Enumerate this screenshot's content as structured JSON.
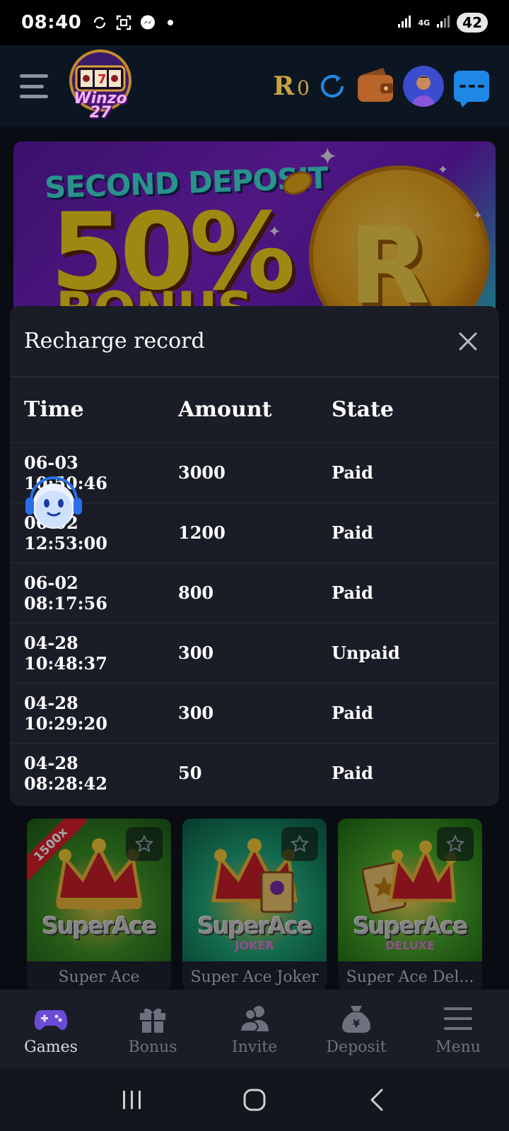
{
  "status_bar": {
    "time": "08:40",
    "network": "4G",
    "battery": "42"
  },
  "header": {
    "logo_text": "Winzo 27",
    "balance_currency": "R",
    "balance_value": "0"
  },
  "banner": {
    "line1": "SECOND DEPOSIT",
    "line2": "50%",
    "line3": "BONUS",
    "coin_symbol": "R"
  },
  "recharge_record": {
    "title": "Recharge record",
    "columns": [
      "Time",
      "Amount",
      "State"
    ],
    "rows": [
      {
        "time": "06-03 10:50:46",
        "amount": "3000",
        "state": "Paid"
      },
      {
        "time": "06-02 12:53:00",
        "amount": "1200",
        "state": "Paid"
      },
      {
        "time": "06-02 08:17:56",
        "amount": "800",
        "state": "Paid"
      },
      {
        "time": "04-28 10:48:37",
        "amount": "300",
        "state": "Unpaid"
      },
      {
        "time": "04-28 10:29:20",
        "amount": "300",
        "state": "Paid"
      },
      {
        "time": "04-28 08:28:42",
        "amount": "50",
        "state": "Paid"
      }
    ]
  },
  "games": [
    {
      "name": "Super Ace",
      "art_title": "SuperAce",
      "art_subtitle": "",
      "ribbon": "1500x"
    },
    {
      "name": "Super Ace Joker",
      "art_title": "SuperAce",
      "art_subtitle": "JOKER",
      "ribbon": ""
    },
    {
      "name": "Super Ace Del...",
      "art_title": "SuperAce",
      "art_subtitle": "DELUXE",
      "ribbon": ""
    }
  ],
  "bottom_nav": [
    {
      "label": "Games",
      "icon": "gamepad-icon",
      "active": true
    },
    {
      "label": "Bonus",
      "icon": "gift-icon",
      "active": false
    },
    {
      "label": "Invite",
      "icon": "users-icon",
      "active": false
    },
    {
      "label": "Deposit",
      "icon": "money-bag-icon",
      "active": false
    },
    {
      "label": "Menu",
      "icon": "menu-icon",
      "active": false
    }
  ],
  "colors": {
    "accent_gold": "#c9a341",
    "chat_blue": "#1f88e6",
    "modal_bg": "#1a1d27",
    "active_nav_icon": "#6a4bd6"
  }
}
